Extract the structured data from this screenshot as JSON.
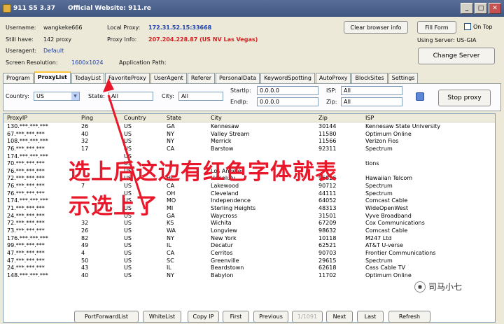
{
  "window": {
    "title": "911 S5 3.37",
    "website": "Official Website: 911.re",
    "btn_min": "_",
    "btn_max": "□",
    "btn_close": "✕"
  },
  "info": {
    "username_label": "Username:",
    "username_value": "wangkeke666",
    "still_have_label": "Still have:",
    "still_have_value": "142 proxy",
    "useragent_label": "Useragent:",
    "useragent_value": "Default",
    "screen_res_label": "Screen Resolution:",
    "screen_res_value": "1600x1024",
    "local_proxy_label": "Local Proxy:",
    "local_proxy_value": "172.31.52.15:33668",
    "proxy_info_label": "Proxy Info:",
    "proxy_info_value": "207.204.228.87 (US NV Las Vegas)",
    "app_path_label": "Application Path:"
  },
  "actions": {
    "clear_browser_info": "Clear browser info",
    "fill_form": "Fill Form",
    "on_top": "On Top",
    "using_server": "Using Server: US-GIA",
    "change_server": "Change Server",
    "stop_proxy": "Stop proxy"
  },
  "tabs": [
    "Program",
    "ProxyList",
    "TodayList",
    "FavoriteProxy",
    "UserAgent",
    "Referer",
    "PersonalData",
    "KeywordSpotting",
    "AutoProxy",
    "BlockSites",
    "Settings"
  ],
  "filters": {
    "country_label": "Country:",
    "country_value": "US",
    "state_label": "State:",
    "state_value": "All",
    "city_label": "City:",
    "city_value": "All",
    "startip_label": "StartIp:",
    "startip_value": "0.0.0.0",
    "endip_label": "EndIp:",
    "endip_value": "0.0.0.0",
    "isp_label": "ISP:",
    "isp_value": "All",
    "zip_label": "Zip:",
    "zip_value": "All"
  },
  "table": {
    "headers": [
      "ProxyIP",
      "Ping",
      "Country",
      "State",
      "City",
      "Zip",
      "ISP"
    ],
    "rows": [
      [
        "130.***.***.***",
        "26",
        "US",
        "GA",
        "Kennesaw",
        "30144",
        "Kennesaw State University"
      ],
      [
        "67.***.***.***",
        "40",
        "US",
        "NY",
        "Valley Stream",
        "11580",
        "Optimum Online"
      ],
      [
        "108.***.***.***",
        "32",
        "US",
        "NY",
        "Merrick",
        "11566",
        "Verizon Fios"
      ],
      [
        "76.***.***.***",
        "17",
        "US",
        "CA",
        "Barstow",
        "92311",
        "Spectrum"
      ],
      [
        "174.***.***.***",
        "",
        "US",
        "",
        "",
        "",
        ""
      ],
      [
        "70.***.***.***",
        "",
        "US",
        "",
        "",
        "",
        "tions"
      ],
      [
        "76.***.***.***",
        "",
        "US",
        "",
        "Los Angeles",
        "",
        ""
      ],
      [
        "72.***.***.***",
        "",
        "US",
        "HI",
        "Honolulu",
        "96826",
        "Hawaiian Telcom"
      ],
      [
        "76.***.***.***",
        "7",
        "US",
        "CA",
        "Lakewood",
        "90712",
        "Spectrum"
      ],
      [
        "76.***.***.***",
        "",
        "US",
        "OH",
        "Cleveland",
        "44111",
        "Spectrum"
      ],
      [
        "174.***.***.***",
        "",
        "US",
        "MO",
        "Independence",
        "64052",
        "Comcast Cable"
      ],
      [
        "71.***.***.***",
        "",
        "US",
        "MI",
        "Sterling Heights",
        "48313",
        "WideOpenWest"
      ],
      [
        "24.***.***.***",
        "",
        "US",
        "GA",
        "Waycross",
        "31501",
        "Vyve Broadband"
      ],
      [
        "72.***.***.***",
        "32",
        "US",
        "KS",
        "Wichita",
        "67209",
        "Cox Communications"
      ],
      [
        "73.***.***.***",
        "26",
        "US",
        "WA",
        "Longview",
        "98632",
        "Comcast Cable"
      ],
      [
        "176.***.***.***",
        "82",
        "US",
        "NY",
        "New York",
        "10118",
        "M247 Ltd"
      ],
      [
        "99.***.***.***",
        "49",
        "US",
        "IL",
        "Decatur",
        "62521",
        "AT&T U-verse"
      ],
      [
        "47.***.***.***",
        "4",
        "US",
        "CA",
        "Cerritos",
        "90703",
        "Frontier Communications"
      ],
      [
        "47.***.***.***",
        "50",
        "US",
        "SC",
        "Greenville",
        "29615",
        "Spectrum"
      ],
      [
        "24.***.***.***",
        "43",
        "US",
        "IL",
        "Beardstown",
        "62618",
        "Cass Cable TV"
      ],
      [
        "148.***.***.***",
        "40",
        "US",
        "NY",
        "Babylon",
        "11702",
        "Optimum Online"
      ]
    ]
  },
  "overlay": {
    "line1": "选上后这边有红色字体就表",
    "line2": "示选上了",
    "color": "#e8182a"
  },
  "bottom": {
    "portforward": "PortForwardList",
    "whitelist": "WhiteList",
    "copy_ip": "Copy IP",
    "first": "First",
    "previous": "Previous",
    "page": "1/1091",
    "next": "Next",
    "last": "Last",
    "refresh": "Refresh"
  },
  "watermark": "司马小七"
}
